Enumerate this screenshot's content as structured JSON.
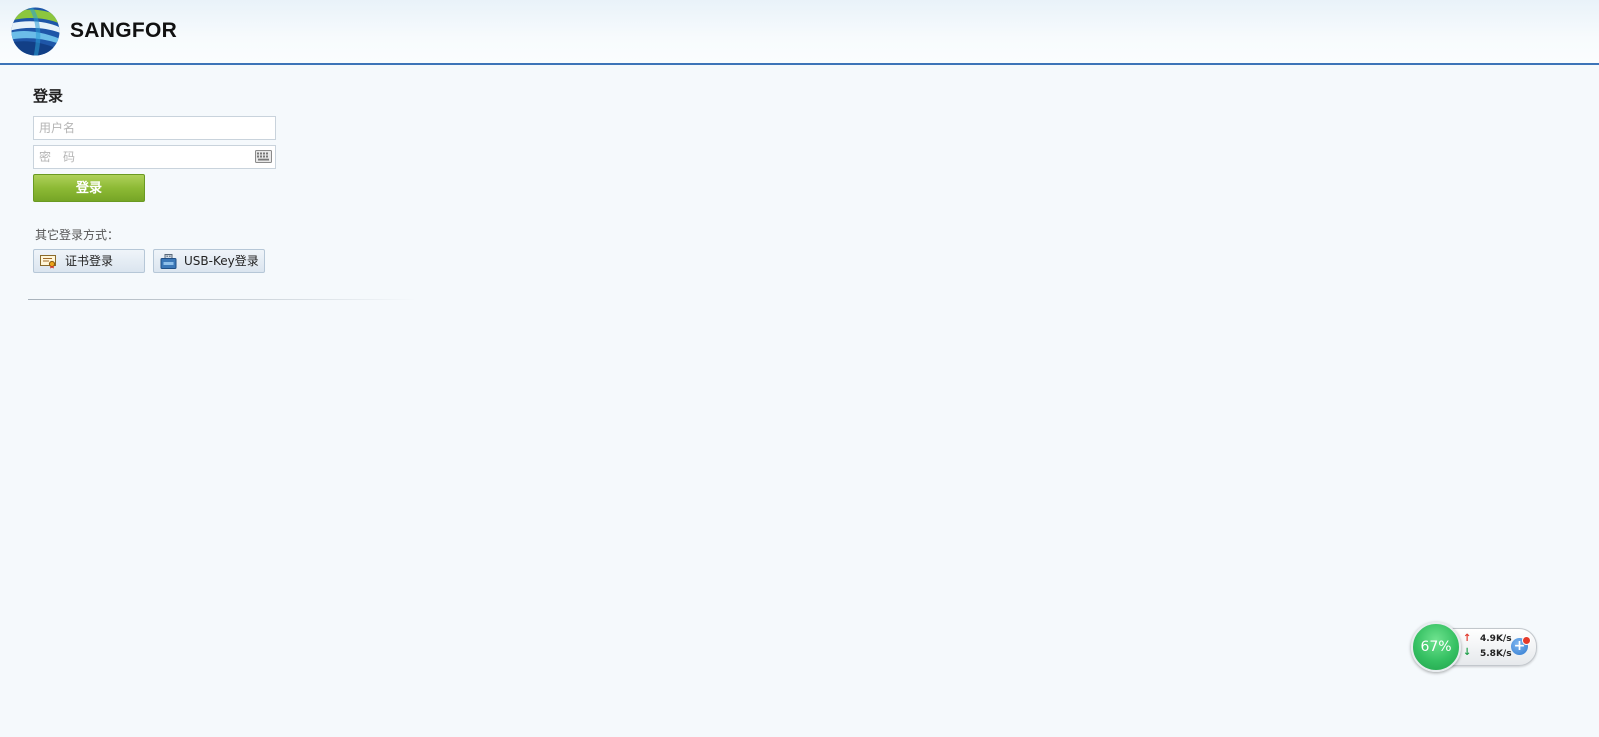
{
  "header": {
    "brand": "SANGFOR",
    "logo_icon": "sangfor-globe-logo",
    "accent_color": "#3d74b8"
  },
  "login": {
    "title": "登录",
    "username_placeholder": "用户名",
    "password_placeholder": "密　码",
    "keyboard_icon": "virtual-keyboard-icon",
    "submit_label": "登录",
    "submit_color": "#8dba35"
  },
  "alt_login": {
    "label": "其它登录方式：",
    "cert_label": "证书登录",
    "cert_icon": "certificate-icon",
    "usb_label": "USB-Key登录",
    "usb_icon": "usb-key-icon"
  },
  "net_widget": {
    "percent": "67%",
    "upload": "4.9K/s",
    "download": "5.8K/s",
    "up_arrow": "↑",
    "down_arrow": "↓",
    "plus": "+",
    "up_color": "#e23b2f",
    "down_color": "#21a04a"
  }
}
